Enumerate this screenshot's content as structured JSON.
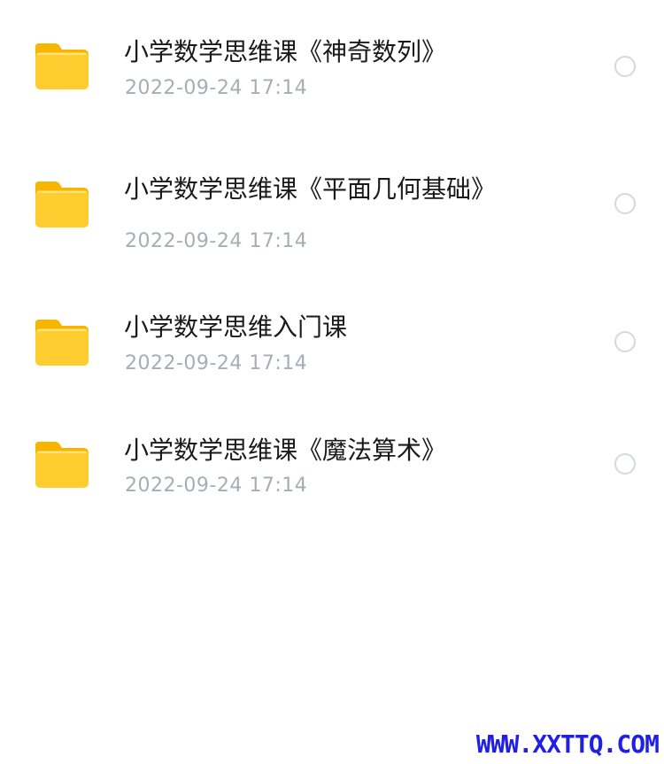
{
  "colors": {
    "folder_body": "#FFCD2F",
    "folder_tab": "#F7B500",
    "title_text": "#1a1a1a",
    "time_text": "#a7adb6",
    "radio_border": "#d5d8dd",
    "watermark": "#1f1fe6"
  },
  "files": [
    {
      "icon": "folder-icon",
      "name": "小学数学思维课《神奇数列》",
      "modified": "2022-09-24 17:14"
    },
    {
      "icon": "folder-icon",
      "name": "小学数学思维课《平面几何基础》",
      "modified": "2022-09-24 17:14"
    },
    {
      "icon": "folder-icon",
      "name": "小学数学思维入门课",
      "modified": "2022-09-24 17:14"
    },
    {
      "icon": "folder-icon",
      "name": "小学数学思维课《魔法算术》",
      "modified": "2022-09-24 17:14"
    }
  ],
  "watermark": "WWW.XXTTQ.COM"
}
